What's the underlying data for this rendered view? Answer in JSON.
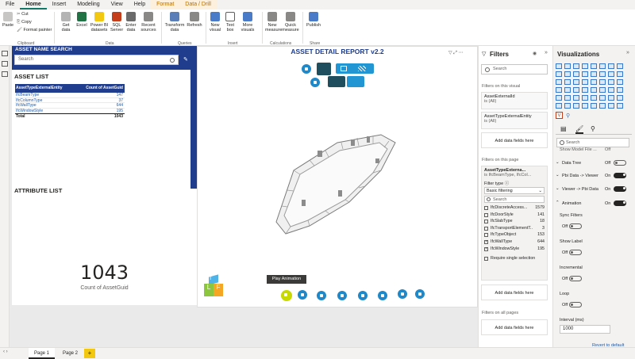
{
  "ribbon": {
    "tabs": [
      "File",
      "Home",
      "Insert",
      "Modeling",
      "View",
      "Help",
      "Format",
      "Data / Drill"
    ],
    "active_tab": "Home",
    "contextual_tabs": [
      "Format",
      "Data / Drill"
    ],
    "buttons": {
      "paste": "Paste",
      "cut": "Cut",
      "copy": "Copy",
      "format_painter": "Format painter",
      "get_data": "Get data",
      "excel": "Excel",
      "pbi_datasets": "Power BI datasets",
      "sql_server": "SQL Server",
      "enter_data": "Enter data",
      "recent_sources": "Recent sources",
      "transform_data": "Transform data",
      "refresh": "Refresh",
      "new_visual": "New visual",
      "text_box": "Text box",
      "more_visuals": "More visuals",
      "new_measure": "New measure",
      "quick_measure": "Quick measure",
      "publish": "Publish"
    },
    "groups": {
      "clipboard": "Clipboard",
      "data": "Data",
      "queries": "Queries",
      "insert": "Insert",
      "calculations": "Calculations",
      "share": "Share"
    }
  },
  "left": {
    "search_title": "ASSET NAME SEARCH",
    "search_placeholder": "Search",
    "asset_list_title": "ASSET LIST",
    "attribute_list_title": "ATTRIBUTE LIST",
    "table": {
      "headers": [
        "AssetTypeExternalEntity",
        "Count of AssetGuid"
      ],
      "rows": [
        [
          "IfcBeamType",
          "147"
        ],
        [
          "IfcColumnType",
          "37"
        ],
        [
          "IfcWallType",
          "644"
        ],
        [
          "IfcWindowStyle",
          "195"
        ]
      ],
      "total_label": "Total",
      "total_value": "1043"
    },
    "card_value": "1043",
    "card_label": "Count of AssetGuid"
  },
  "viewer": {
    "title": "ASSET DETAIL REPORT v2.2",
    "tooltip": "Play Animation",
    "logo_letters": [
      "L",
      "T",
      "F"
    ]
  },
  "filters": {
    "title": "Filters",
    "search_placeholder": "Search",
    "on_visual_label": "Filters on this visual",
    "visual_filters": [
      {
        "field": "AssetExternalId",
        "value": "is (All)"
      },
      {
        "field": "AssetTypeExternalEntity",
        "value": "is (All)"
      }
    ],
    "add_fields": "Add data fields here",
    "on_page_label": "Filters on this page",
    "page_filter_field": "AssetTypeExterna...",
    "page_filter_value": "is IfcBeamType, IfcCol...",
    "filter_type_label": "Filter type",
    "filter_type_value": "Basic filtering",
    "list_search": "Search",
    "list": [
      {
        "name": "IfcDiscreteAccess...",
        "count": "1579",
        "checked": false
      },
      {
        "name": "IfcDoorStyle",
        "count": "141",
        "checked": false
      },
      {
        "name": "IfcSlabType",
        "count": "18",
        "checked": false
      },
      {
        "name": "IfcTransportElementT...",
        "count": "3",
        "checked": false
      },
      {
        "name": "IfcTypeObject",
        "count": "153",
        "checked": false
      },
      {
        "name": "IfcWallType",
        "count": "644",
        "checked": true
      },
      {
        "name": "IfcWindowStyle",
        "count": "195",
        "checked": true
      }
    ],
    "require_single": "Require single selection",
    "on_all_pages_label": "Filters on all pages"
  },
  "viz": {
    "title": "Visualizations",
    "search_placeholder": "Search",
    "show_model_row": "Show Model File ...",
    "sections": [
      {
        "label": "Data Tree",
        "state": "Off"
      },
      {
        "label": "Pbi Data -> Viewer",
        "state": "On"
      },
      {
        "label": "Viewer -> Pbi Data",
        "state": "On"
      },
      {
        "label": "Animation",
        "state": "On"
      }
    ],
    "props": [
      {
        "label": "Sync Filters",
        "state": "Off"
      },
      {
        "label": "Show Label",
        "state": "Off"
      },
      {
        "label": "Incremental",
        "state": "Off"
      },
      {
        "label": "Loop",
        "state": "Off"
      }
    ],
    "interval_label": "Interval (ms)",
    "interval_value": "1000",
    "revert": "Revert to default"
  },
  "pages": [
    "Page 1",
    "Page 2"
  ],
  "add_page": "+"
}
